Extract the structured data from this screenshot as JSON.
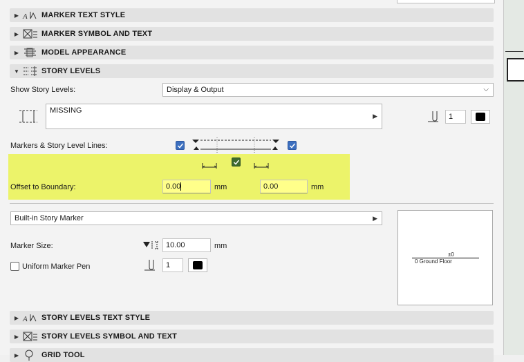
{
  "sections": {
    "marker_text_style": "MARKER TEXT STYLE",
    "marker_symbol_text": "MARKER SYMBOL AND TEXT",
    "model_appearance": "MODEL APPEARANCE",
    "story_levels": "STORY LEVELS",
    "story_levels_text_style": "STORY LEVELS TEXT STYLE",
    "story_levels_symbol_text": "STORY LEVELS SYMBOL AND TEXT",
    "grid_tool": "GRID TOOL"
  },
  "story_levels": {
    "show_label": "Show Story Levels:",
    "show_value": "Display & Output",
    "line_type_value": "MISSING",
    "pen_number": "1",
    "markers_lines_label": "Markers & Story Level Lines:",
    "offset_label": "Offset to Boundary:",
    "offset_left": "0.00",
    "offset_right": "0.00",
    "unit": "mm",
    "marker_type": "Built-in Story Marker",
    "marker_size_label": "Marker Size:",
    "marker_size_value": "10.00",
    "uniform_pen_label": "Uniform Marker Pen",
    "marker_pen_number": "1"
  },
  "preview": {
    "level_value": "±0",
    "floor_label": "0 Ground Floor"
  },
  "colors": {
    "highlight": "#ecf36a",
    "checkbox_blue": "#3c6fbf",
    "checkbox_green": "#3d6b2e"
  }
}
